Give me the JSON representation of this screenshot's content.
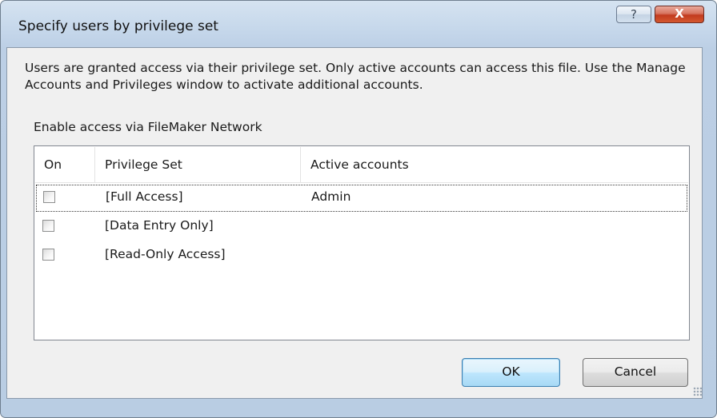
{
  "window": {
    "title": "Specify users by privilege set",
    "help_glyph": "?",
    "close_glyph": "X"
  },
  "description": "Users are granted access via their privilege set. Only active accounts can access this file. Use the Manage Accounts and Privileges window to activate additional accounts.",
  "section_label": "Enable access via FileMaker Network",
  "table": {
    "columns": [
      "On",
      "Privilege Set",
      "Active accounts"
    ],
    "rows": [
      {
        "on": false,
        "privilege_set": "[Full Access]",
        "active_accounts": "Admin"
      },
      {
        "on": false,
        "privilege_set": "[Data Entry Only]",
        "active_accounts": ""
      },
      {
        "on": false,
        "privilege_set": "[Read-Only Access]",
        "active_accounts": ""
      }
    ]
  },
  "buttons": {
    "ok": "OK",
    "cancel": "Cancel"
  },
  "icons": {
    "help": "help-icon",
    "close": "close-icon",
    "resize": "resize-grip-icon"
  },
  "colors": {
    "titlebar": "#c4d6ea",
    "close_button": "#c23a1f",
    "default_button": "#bee6fd"
  }
}
